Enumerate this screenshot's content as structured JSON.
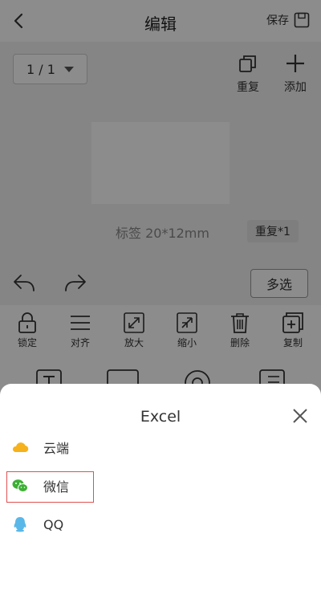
{
  "header": {
    "title": "编辑",
    "save_label": "保存"
  },
  "page_selector": {
    "value": "1 / 1"
  },
  "top_tools": [
    {
      "label": "重复",
      "icon": "duplicate-icon"
    },
    {
      "label": "添加",
      "icon": "plus-icon"
    }
  ],
  "label": {
    "size_text": "标签 20*12mm",
    "repeat_badge": "重复*1"
  },
  "actions": {
    "multi_select_label": "多选"
  },
  "toolbar": [
    {
      "label": "锁定",
      "icon": "lock-icon"
    },
    {
      "label": "对齐",
      "icon": "align-icon"
    },
    {
      "label": "放大",
      "icon": "zoom-in-icon"
    },
    {
      "label": "缩小",
      "icon": "zoom-out-icon"
    },
    {
      "label": "删除",
      "icon": "trash-icon"
    },
    {
      "label": "复制",
      "icon": "copy-icon"
    }
  ],
  "sheet": {
    "title": "Excel",
    "options": [
      {
        "label": "云端",
        "icon": "cloud-icon",
        "color": "#f5b21d"
      },
      {
        "label": "微信",
        "icon": "wechat-icon",
        "color": "#3cb034"
      },
      {
        "label": "QQ",
        "icon": "qq-icon",
        "color": "#5ab8e8"
      }
    ]
  }
}
